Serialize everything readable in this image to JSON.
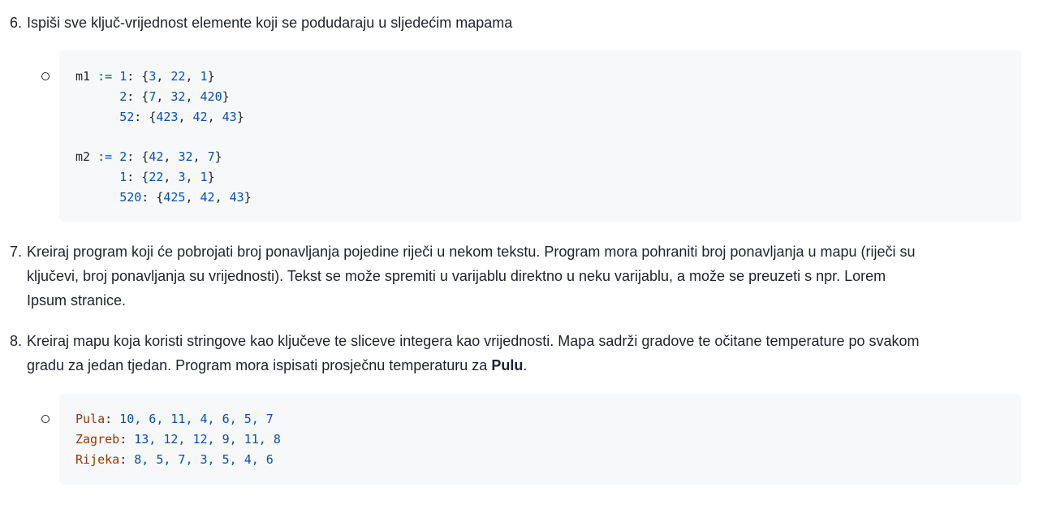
{
  "items": [
    {
      "number": "6.",
      "text": "Ispiši sve ključ-vrijednost elemente koji se podudaraju u sljedećim mapama"
    },
    {
      "number": "7.",
      "lines": [
        "Kreiraj program koji će pobrojati broj ponavljanja pojedine riječi u nekom tekstu. Program mora pohraniti broj ponavljanja u mapu (riječi su",
        "ključevi, broj ponavljanja su vrijednosti). Tekst se može spremiti u varijablu direktno u neku varijablu, a može se preuzeti s npr. Lorem",
        "Ipsum stranice."
      ]
    },
    {
      "number": "8.",
      "line1": "Kreiraj mapu koja koristi stringove kao ključeve te sliceve integera kao vrijednosti. Mapa sadrži gradove te očitane temperature po svakom",
      "line2_before": "gradu za jedan tjedan. Program mora ispisati prosječnu temperaturu za ",
      "line2_bold": "Pulu",
      "line2_after": "."
    }
  ],
  "code_block_1": {
    "m1": {
      "name": "m1",
      "op": ":=",
      "rows": [
        {
          "key": "1",
          "values": "{3, 22, 1}"
        },
        {
          "key": "2",
          "values": "{7, 32, 420}"
        },
        {
          "key": "52",
          "values": "{423, 42, 43}"
        }
      ]
    },
    "m2": {
      "name": "m2",
      "op": ":=",
      "rows": [
        {
          "key": "2",
          "values": "{42, 32, 7}"
        },
        {
          "key": "1",
          "values": "{22, 3, 1}"
        },
        {
          "key": "520",
          "values": "{425, 42, 43}"
        }
      ]
    }
  },
  "code_block_2": {
    "rows": [
      {
        "city": "Pula",
        "values": "10, 6, 11, 4, 6, 5, 7"
      },
      {
        "city": "Zagreb",
        "values": "13, 12, 12, 9, 11, 8"
      },
      {
        "city": "Rijeka",
        "values": "8, 5, 7, 3, 5, 4, 6"
      }
    ]
  },
  "colors": {
    "text": "#1f2328",
    "code_background": "#f6f8fa",
    "code_number": "#0550ae",
    "code_key": "#953800"
  }
}
